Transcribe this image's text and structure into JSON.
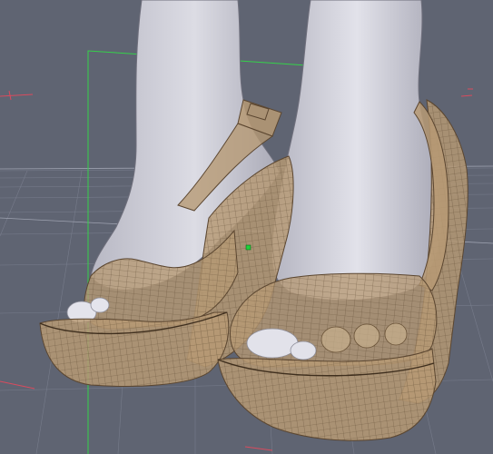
{
  "viewport": {
    "background_color": "#5f6472",
    "floor_grid_color": "#8a8fa0",
    "selection_box_color": "#35d24a",
    "axis_color": "#d94b5e",
    "skin_color": "#cdcdd6",
    "skin_shadow_color": "#9a9aa8",
    "shoe_fill_color": "#b79a74",
    "shoe_wire_color": "#5b4630",
    "pivot_marker_color": "#1fd23a"
  }
}
